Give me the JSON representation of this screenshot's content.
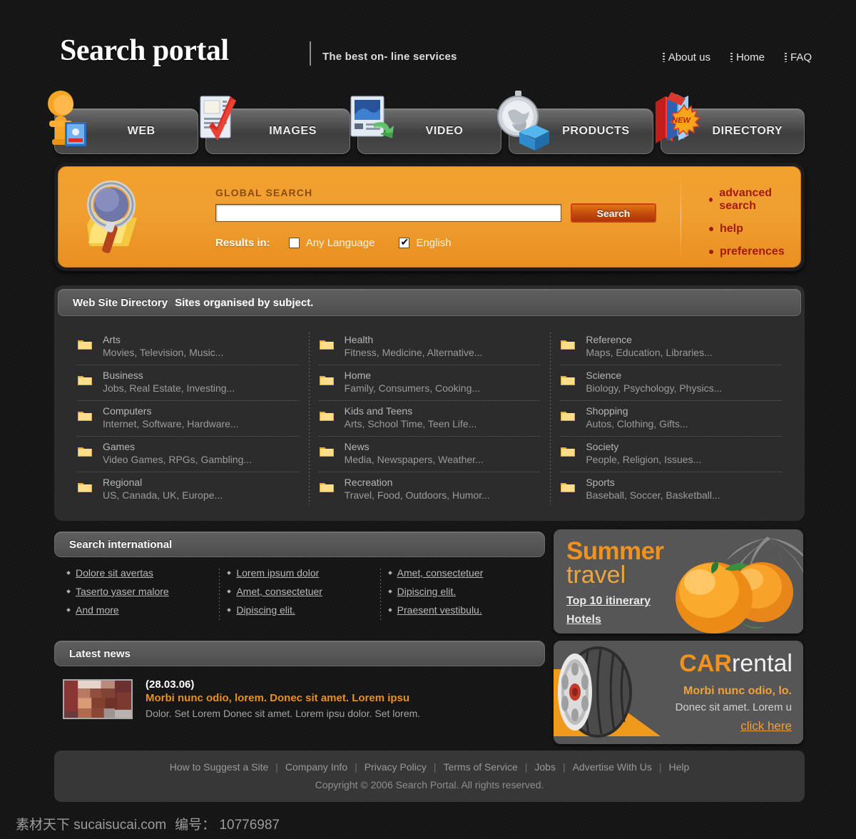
{
  "header": {
    "logo": "Search portal",
    "tagline": "The best on- line services",
    "nav": [
      {
        "label": "About us"
      },
      {
        "label": "Home"
      },
      {
        "label": "FAQ"
      }
    ]
  },
  "tabs": [
    {
      "label": "WEB",
      "icon": "person-book-icon"
    },
    {
      "label": "IMAGES",
      "icon": "checklist-icon"
    },
    {
      "label": "VIDEO",
      "icon": "monitor-arrow-icon"
    },
    {
      "label": "PRODUCTS",
      "icon": "watch-box-icon"
    },
    {
      "label": "DIRECTORY",
      "icon": "books-new-icon",
      "badge": "NEW"
    }
  ],
  "search": {
    "icon": "magnifier-folder-icon",
    "label": "GLOBAL SEARCH",
    "input_value": "",
    "placeholder": "",
    "button": "Search",
    "results_label": "Results in:",
    "options": [
      {
        "label": "Any Language",
        "checked": false
      },
      {
        "label": "English",
        "checked": true
      }
    ],
    "links": [
      {
        "label": "advanced search"
      },
      {
        "label": "help"
      },
      {
        "label": "preferences"
      }
    ],
    "panel_color": "#f0a032",
    "link_color": "#a31a0c"
  },
  "directory": {
    "title": "Web Site Directory",
    "subtitle": "Sites organised by subject.",
    "columns": [
      [
        {
          "category": "Arts",
          "desc": "Movies, Television, Music..."
        },
        {
          "category": "Business",
          "desc": "Jobs, Real Estate, Investing..."
        },
        {
          "category": "Computers",
          "desc": "Internet, Software, Hardware..."
        },
        {
          "category": "Games",
          "desc": "Video Games, RPGs, Gambling..."
        },
        {
          "category": "Regional",
          "desc": "US, Canada, UK, Europe..."
        }
      ],
      [
        {
          "category": "Health",
          "desc": "Fitness, Medicine, Alternative..."
        },
        {
          "category": "Home",
          "desc": "Family, Consumers, Cooking..."
        },
        {
          "category": "Kids and Teens",
          "desc": "Arts, School Time, Teen Life..."
        },
        {
          "category": "News",
          "desc": "Media, Newspapers, Weather..."
        },
        {
          "category": "Recreation",
          "desc": "Travel, Food, Outdoors, Humor..."
        }
      ],
      [
        {
          "category": "Reference",
          "desc": "Maps, Education, Libraries..."
        },
        {
          "category": "Science",
          "desc": "Biology, Psychology, Physics..."
        },
        {
          "category": "Shopping",
          "desc": "Autos, Clothing, Gifts..."
        },
        {
          "category": "Society",
          "desc": "People, Religion, Issues..."
        },
        {
          "category": "Sports",
          "desc": "Baseball, Soccer, Basketball..."
        }
      ]
    ]
  },
  "international": {
    "title": "Search international",
    "columns": [
      [
        {
          "label": "Dolore sit avertas"
        },
        {
          "label": "Taserto yaser malore"
        },
        {
          "label": "And more"
        }
      ],
      [
        {
          "label": "Lorem ipsum dolor"
        },
        {
          "label": "Amet, consectetuer"
        },
        {
          "label": "Dipiscing elit."
        }
      ],
      [
        {
          "label": "Amet, consectetuer"
        },
        {
          "label": "Dipiscing elit."
        },
        {
          "label": "Praesent vestibulu."
        }
      ]
    ]
  },
  "news": {
    "title": "Latest news",
    "thumbnail": "news-thumbnail-image",
    "date": "(28.03.06)",
    "headline": "Morbi nunc odio, lorem.  Donec sit amet. Lorem ipsu",
    "text": "Dolor. Set Lorem Donec sit amet. Lorem ipsu dolor. Set lorem."
  },
  "banners": {
    "travel": {
      "title_1": "Summer",
      "title_2": "travel",
      "link_1": "Top 10 itinerary",
      "link_2": "Hotels",
      "image": "oranges-palm-image",
      "accent": "#f0921d"
    },
    "car": {
      "title_1": "CAR",
      "title_2": "rental",
      "line_1": "Morbi nunc odio, lo.",
      "line_2": "Donec sit amet. Lorem u",
      "link": "click here",
      "image": "tire-image",
      "accent": "#f0921d"
    }
  },
  "footer": {
    "links": [
      {
        "label": "How to Suggest a Site"
      },
      {
        "label": "Company Info"
      },
      {
        "label": "Privacy Policy"
      },
      {
        "label": "Terms of Service"
      },
      {
        "label": "Jobs"
      },
      {
        "label": "Advertise With Us"
      },
      {
        "label": "Help"
      }
    ],
    "separator": "|",
    "copyright": "Copyright © 2006 Search Portal. All rights reserved."
  },
  "watermark": {
    "site": "素材天下 sucaisucai.com",
    "id": "编号： 10776987"
  }
}
